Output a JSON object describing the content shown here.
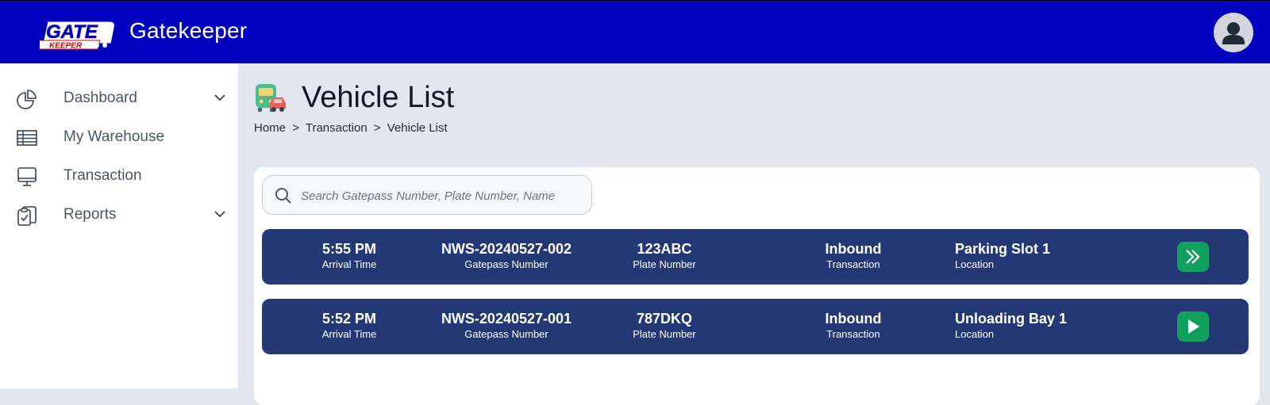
{
  "header": {
    "logo_text": "GATEKEEPER",
    "app_title": "Gatekeeper"
  },
  "sidebar": {
    "items": [
      {
        "label": "Dashboard",
        "icon": "pie-chart-icon",
        "has_chevron": true
      },
      {
        "label": "My Warehouse",
        "icon": "table-icon",
        "has_chevron": false
      },
      {
        "label": "Transaction",
        "icon": "monitor-icon",
        "has_chevron": false
      },
      {
        "label": "Reports",
        "icon": "clipboard-icon",
        "has_chevron": true
      }
    ]
  },
  "page": {
    "title": "Vehicle List",
    "icon": "vehicles-icon",
    "breadcrumb": [
      "Home",
      ">",
      "Transaction",
      ">",
      "Vehicle List"
    ]
  },
  "search": {
    "placeholder": "Search Gatepass Number, Plate Number, Name",
    "value": ""
  },
  "vehicles": [
    {
      "arrival_time": "5:55 PM",
      "arrival_label": "Arrival Time",
      "gatepass": "NWS-20240527-002",
      "gatepass_label": "Gatepass Number",
      "plate": "123ABC",
      "plate_label": "Plate Number",
      "transaction": "Inbound",
      "transaction_label": "Transaction",
      "location": "Parking Slot 1",
      "location_label": "Location",
      "action_icon": "double-chevron-right-icon"
    },
    {
      "arrival_time": "5:52 PM",
      "arrival_label": "Arrival Time",
      "gatepass": "NWS-20240527-001",
      "gatepass_label": "Gatepass Number",
      "plate": "787DKQ",
      "plate_label": "Plate Number",
      "transaction": "Inbound",
      "transaction_label": "Transaction",
      "location": "Unloading Bay 1",
      "location_label": "Location",
      "action_icon": "play-icon"
    }
  ],
  "colors": {
    "header_bg": "#0303bf",
    "row_bg": "#243876",
    "action_button": "#11a05e",
    "page_bg": "#e2e7ef"
  }
}
